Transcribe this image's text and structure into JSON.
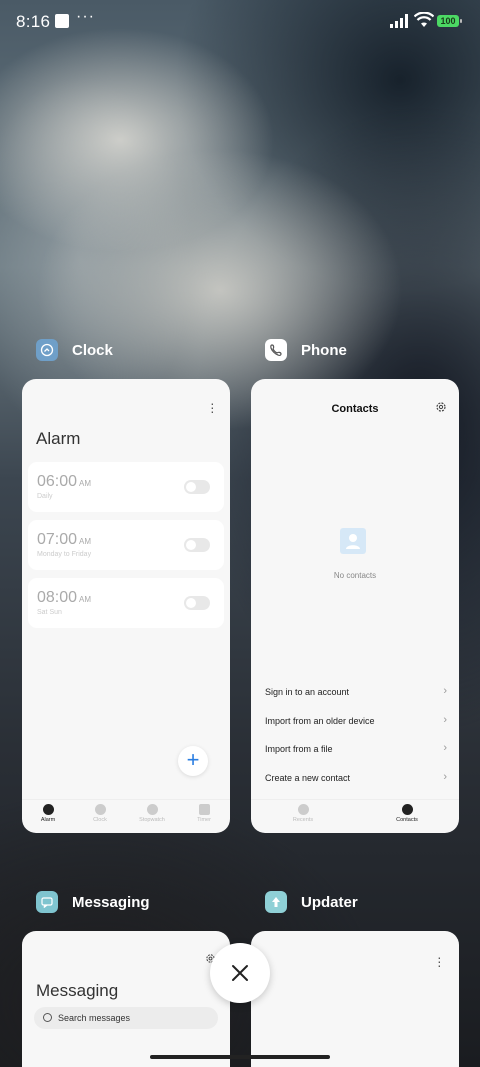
{
  "status": {
    "time": "8:16",
    "dots": "···",
    "battery": "100"
  },
  "apps": {
    "clock": {
      "label": "Clock",
      "title": "Alarm",
      "alarms": [
        {
          "time": "06:00",
          "ampm": "AM",
          "repeat": "Daily"
        },
        {
          "time": "07:00",
          "ampm": "AM",
          "repeat": "Monday to Friday"
        },
        {
          "time": "08:00",
          "ampm": "AM",
          "repeat": "Sat Sun"
        }
      ],
      "tabs": [
        "Alarm",
        "Clock",
        "Stopwatch",
        "Timer"
      ],
      "active_tab": "Alarm"
    },
    "phone": {
      "label": "Phone",
      "title": "Contacts",
      "empty_text": "No contacts",
      "actions": [
        "Sign in to an account",
        "Import from an older device",
        "Import from a file",
        "Create a new contact"
      ],
      "tabs": [
        "Recents",
        "Contacts"
      ],
      "active_tab": "Contacts"
    },
    "messaging": {
      "label": "Messaging",
      "title": "Messaging",
      "search_placeholder": "Search messages"
    },
    "updater": {
      "label": "Updater"
    }
  },
  "colors": {
    "accent": "#2a7de1",
    "clock_icon": "#6f9fc8",
    "messaging_icon": "#7fc4cf",
    "updater_icon": "#8fd0d6"
  },
  "icons": {
    "close": "close-icon",
    "add": "plus-icon"
  }
}
